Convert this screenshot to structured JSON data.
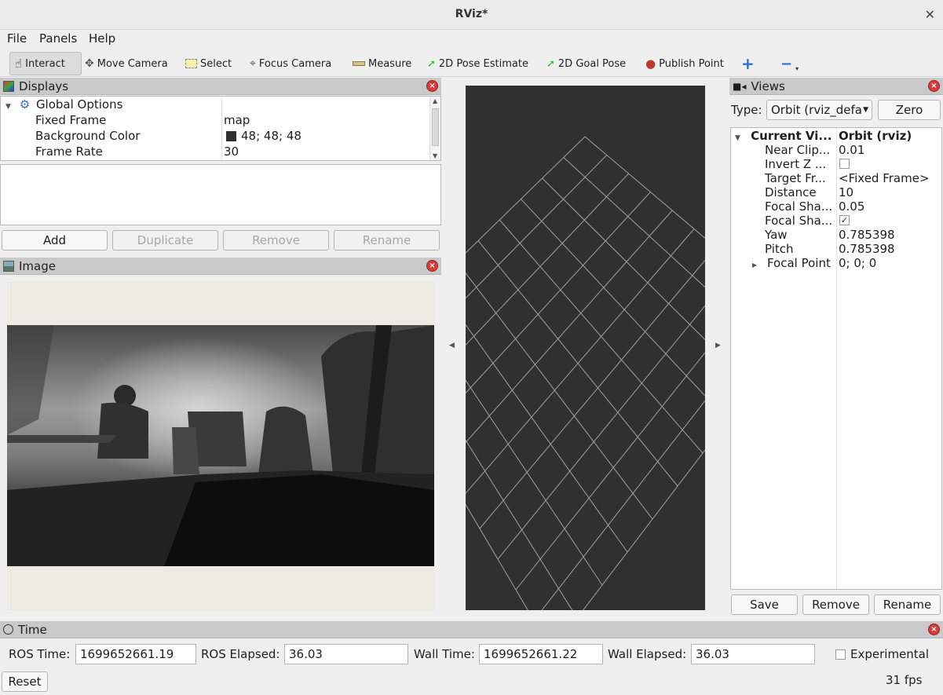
{
  "window": {
    "title": "RViz*"
  },
  "menu": [
    "File",
    "Panels",
    "Help"
  ],
  "toolbar": {
    "interact": "Interact",
    "move_camera": "Move Camera",
    "select": "Select",
    "focus_camera": "Focus Camera",
    "measure": "Measure",
    "pose_estimate": "2D Pose Estimate",
    "goal_pose": "2D Goal Pose",
    "publish_point": "Publish Point"
  },
  "displays": {
    "title": "Displays",
    "global_options": "Global Options",
    "rows": [
      {
        "label": "Fixed Frame",
        "value": "map"
      },
      {
        "label": "Background Color",
        "value": "48; 48; 48"
      },
      {
        "label": "Frame Rate",
        "value": "30"
      }
    ],
    "background_color": "#303030",
    "buttons": {
      "add": "Add",
      "duplicate": "Duplicate",
      "remove": "Remove",
      "rename": "Rename"
    }
  },
  "image_panel": {
    "title": "Image"
  },
  "views": {
    "title": "Views",
    "type_label": "Type:",
    "type_value": "Orbit (rviz_defa",
    "zero": "Zero",
    "current_label": "Current Vi...",
    "current_value": "Orbit (rviz)",
    "props": [
      {
        "label": "Near Clip...",
        "value": "0.01"
      },
      {
        "label": "Invert Z ...",
        "value": ""
      },
      {
        "label": "Target Fr...",
        "value": "<Fixed Frame>"
      },
      {
        "label": "Distance",
        "value": "10"
      },
      {
        "label": "Focal Sha...",
        "value": "0.05"
      },
      {
        "label": "Focal Sha...",
        "value": ""
      },
      {
        "label": "Yaw",
        "value": "0.785398"
      },
      {
        "label": "Pitch",
        "value": "0.785398"
      },
      {
        "label": "Focal Point",
        "value": "0; 0; 0"
      }
    ],
    "invert_z_checked": false,
    "focal_shape_fixed_checked": true,
    "buttons": {
      "save": "Save",
      "remove": "Remove",
      "rename": "Rename"
    }
  },
  "time": {
    "title": "Time",
    "ros_time_label": "ROS Time:",
    "ros_time": "1699652661.19",
    "ros_elapsed_label": "ROS Elapsed:",
    "ros_elapsed": "36.03",
    "wall_time_label": "Wall Time:",
    "wall_time": "1699652661.22",
    "wall_elapsed_label": "Wall Elapsed:",
    "wall_elapsed": "36.03",
    "experimental": "Experimental",
    "reset": "Reset",
    "fps": "31 fps"
  }
}
